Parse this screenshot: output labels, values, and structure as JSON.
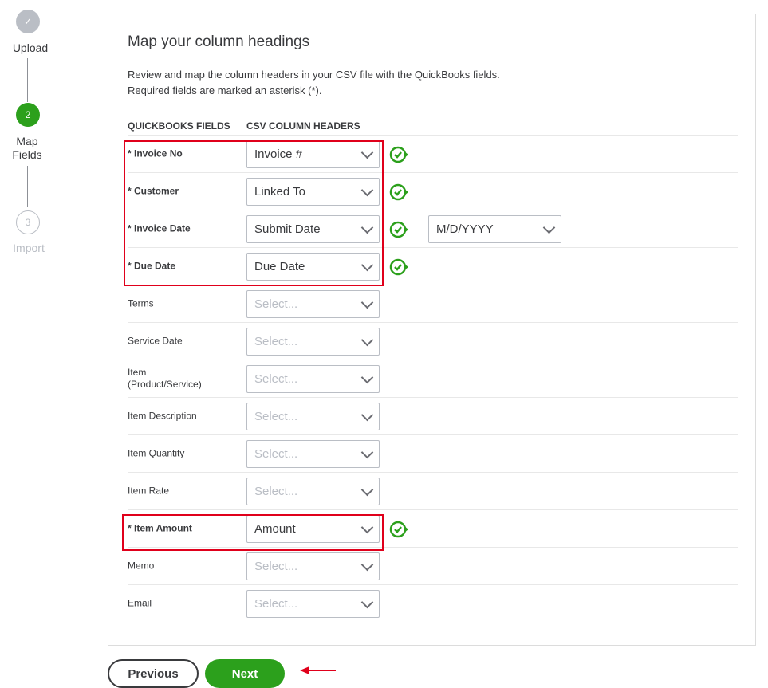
{
  "stepper": {
    "steps": [
      {
        "number": "✓",
        "label": "Upload"
      },
      {
        "number": "2",
        "label_line1": "Map",
        "label_line2": "Fields"
      },
      {
        "number": "3",
        "label": "Import"
      }
    ]
  },
  "card": {
    "title": "Map your column headings",
    "description_line1": "Review and map the column headers in your CSV file with the QuickBooks fields.",
    "description_line2": "Required fields are marked an asterisk (*).",
    "col_header_fields": "QUICKBOOKS FIELDS",
    "col_header_csv": "CSV COLUMN HEADERS"
  },
  "rows": [
    {
      "label": "* Invoice No",
      "value": "Invoice #",
      "required": true,
      "mapped": true
    },
    {
      "label": "* Customer",
      "value": "Linked To",
      "required": true,
      "mapped": true
    },
    {
      "label": "* Invoice Date",
      "value": "Submit Date",
      "required": true,
      "mapped": true,
      "date_format": "M/D/YYYY"
    },
    {
      "label": "* Due Date",
      "value": "Due Date",
      "required": true,
      "mapped": true
    },
    {
      "label": "Terms",
      "value": "Select...",
      "required": false,
      "mapped": false
    },
    {
      "label": "Service Date",
      "value": "Select...",
      "required": false,
      "mapped": false
    },
    {
      "label": "Item (Product/Service)",
      "label_line1": "Item",
      "label_line2": "(Product/Service)",
      "value": "Select...",
      "required": false,
      "mapped": false
    },
    {
      "label": "Item Description",
      "value": "Select...",
      "required": false,
      "mapped": false
    },
    {
      "label": "Item Quantity",
      "value": "Select...",
      "required": false,
      "mapped": false
    },
    {
      "label": "Item Rate",
      "value": "Select...",
      "required": false,
      "mapped": false
    },
    {
      "label": "* Item Amount",
      "value": "Amount",
      "required": true,
      "mapped": true
    },
    {
      "label": "Memo",
      "value": "Select...",
      "required": false,
      "mapped": false
    },
    {
      "label": "Email",
      "value": "Select...",
      "required": false,
      "mapped": false
    }
  ],
  "footer": {
    "previous_label": "Previous",
    "next_label": "Next"
  },
  "colors": {
    "accent_green": "#2ca01c",
    "highlight_red": "#e0001b"
  }
}
